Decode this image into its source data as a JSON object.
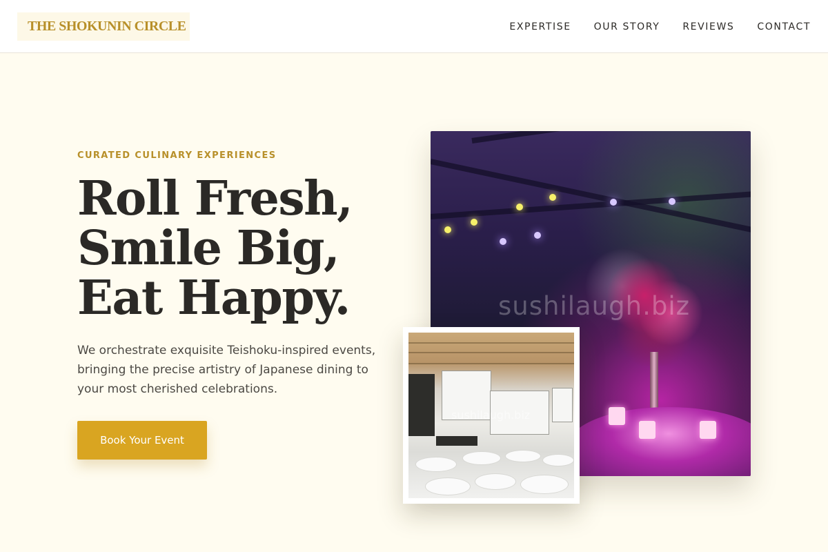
{
  "header": {
    "logo": "THE SHOKUNIN CIRCLE",
    "nav": [
      "EXPERTISE",
      "OUR STORY",
      "REVIEWS",
      "CONTACT"
    ]
  },
  "hero": {
    "eyebrow": "CURATED CULINARY EXPERIENCES",
    "headline": "Roll Fresh, Smile Big, Eat Happy.",
    "body": "We orchestrate exquisite Teishoku-inspired events, bringing the precise artistry of Japanese dining to your most cherished celebrations.",
    "cta_label": "Book Your Event"
  },
  "images": {
    "main_watermark": "sushilaugh.biz",
    "inset_watermark": "sushilaugh.biz"
  },
  "colors": {
    "background": "#fffcf0",
    "accent": "#d9a521",
    "logo": "#b8902a",
    "text": "#2b2926"
  }
}
